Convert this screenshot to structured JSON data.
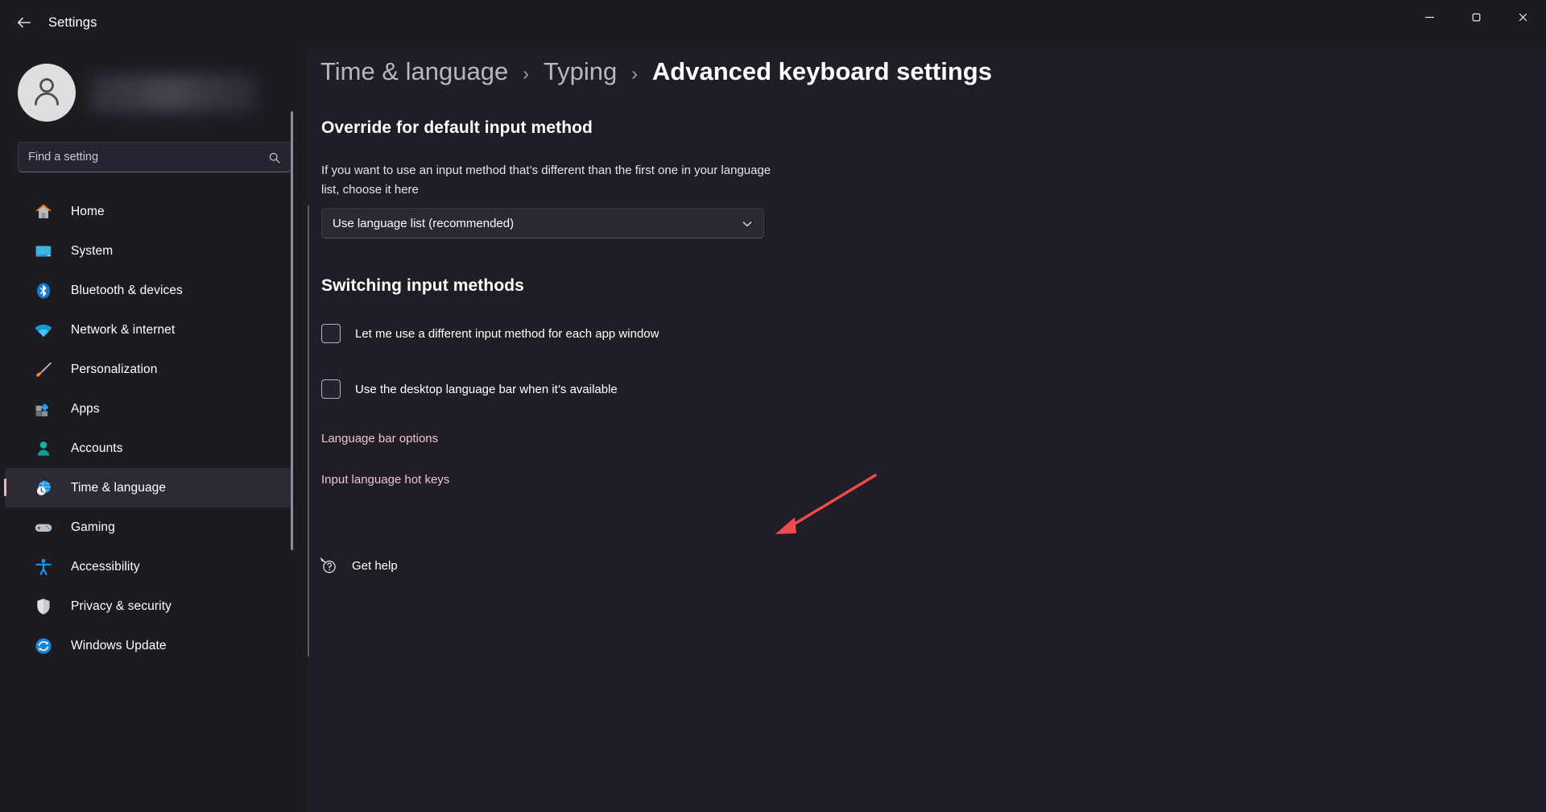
{
  "window": {
    "app_title": "Settings",
    "back_icon": "back-arrow-icon",
    "minimize_label": "Minimize",
    "maximize_label": "Restore",
    "close_label": "Close",
    "background_color": "#1d1a22",
    "content_background_color": "#201d26",
    "accent_color": "#e8b5c4",
    "link_color": "#edc4d0",
    "annotation_color": "#f04a4a"
  },
  "sidebar": {
    "account": {
      "avatar_icon": "person-avatar-icon",
      "name_redacted": true
    },
    "search": {
      "placeholder": "Find a setting",
      "value": "",
      "icon": "search-icon"
    },
    "items": [
      {
        "label": "Home",
        "icon": "home-icon",
        "selected": false
      },
      {
        "label": "System",
        "icon": "system-monitor-icon",
        "selected": false
      },
      {
        "label": "Bluetooth & devices",
        "icon": "bluetooth-icon",
        "selected": false
      },
      {
        "label": "Network & internet",
        "icon": "wifi-icon",
        "selected": false
      },
      {
        "label": "Personalization",
        "icon": "paintbrush-icon",
        "selected": false
      },
      {
        "label": "Apps",
        "icon": "apps-blocks-icon",
        "selected": false
      },
      {
        "label": "Accounts",
        "icon": "account-person-icon",
        "selected": false
      },
      {
        "label": "Time & language",
        "icon": "globe-clock-icon",
        "selected": true
      },
      {
        "label": "Gaming",
        "icon": "gamepad-icon",
        "selected": false
      },
      {
        "label": "Accessibility",
        "icon": "accessibility-person-icon",
        "selected": false
      },
      {
        "label": "Privacy & security",
        "icon": "shield-icon",
        "selected": false
      },
      {
        "label": "Windows Update",
        "icon": "update-refresh-icon",
        "selected": false
      }
    ]
  },
  "main": {
    "breadcrumb": {
      "parts": [
        {
          "label": "Time & language",
          "current": false
        },
        {
          "label": "Typing",
          "current": false
        },
        {
          "label": "Advanced keyboard settings",
          "current": true
        }
      ],
      "separator": "›"
    },
    "override_section": {
      "heading": "Override for default input method",
      "description": "If you want to use an input method that’s different than the first one in your language list, choose it here",
      "combobox": {
        "value": "Use language list (recommended)",
        "chevron_icon": "chevron-down-icon"
      }
    },
    "switching_section": {
      "heading": "Switching input methods",
      "checkboxes": [
        {
          "label": "Let me use a different input method for each app window",
          "checked": false
        },
        {
          "label": "Use the desktop language bar when it’s available",
          "checked": false
        }
      ],
      "links": [
        {
          "label": "Language bar options"
        },
        {
          "label": "Input language hot keys"
        }
      ]
    },
    "get_help": {
      "label": "Get help",
      "icon": "help-question-icon"
    }
  }
}
